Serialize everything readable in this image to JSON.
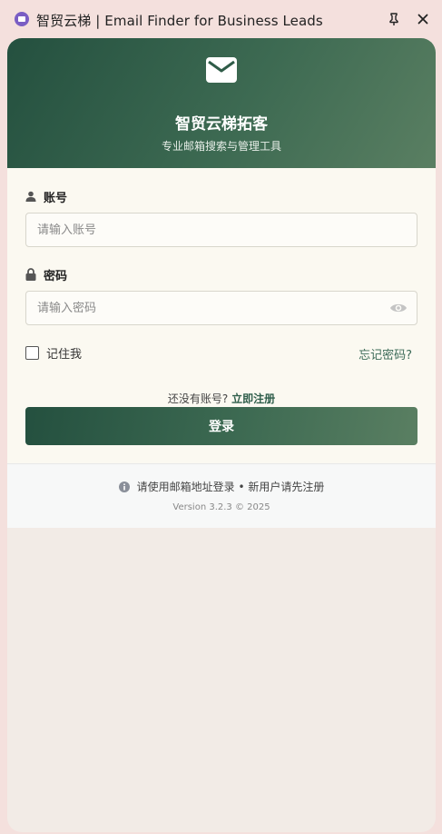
{
  "window": {
    "title": "智贸云梯 | Email Finder for Business Leads",
    "app_icon": "mail-logo-icon",
    "pin_icon": "pin-icon",
    "close_icon": "close-icon"
  },
  "brand": {
    "icon": "envelope-icon",
    "title": "智贸云梯拓客",
    "subtitle": "专业邮箱搜索与管理工具"
  },
  "form": {
    "account": {
      "icon": "user-icon",
      "label": "账号",
      "placeholder": "请输入账号",
      "value": ""
    },
    "password": {
      "icon": "lock-icon",
      "label": "密码",
      "placeholder": "请输入密码",
      "value": "",
      "toggle_icon": "eye-icon"
    },
    "remember_label": "记住我",
    "remember_checked": false,
    "forgot_label": "忘记密码?",
    "register_prompt": "还没有账号?",
    "register_link": "立即注册",
    "login_label": "登录"
  },
  "footer": {
    "info_icon": "info-icon",
    "hint": "请使用邮箱地址登录 • 新用户请先注册",
    "version": "Version 3.2.3 © 2025"
  },
  "colors": {
    "brand_dark": "#24503f",
    "brand_light": "#5a7f62",
    "page_bg": "#f4e0dd",
    "form_bg": "#fbf9f1",
    "link": "#3c6b58"
  }
}
